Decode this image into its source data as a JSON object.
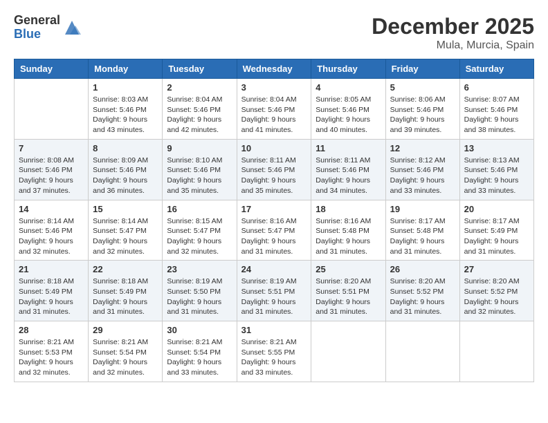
{
  "logo": {
    "general": "General",
    "blue": "Blue"
  },
  "title": "December 2025",
  "location": "Mula, Murcia, Spain",
  "days_of_week": [
    "Sunday",
    "Monday",
    "Tuesday",
    "Wednesday",
    "Thursday",
    "Friday",
    "Saturday"
  ],
  "weeks": [
    [
      {
        "day": "",
        "info": ""
      },
      {
        "day": "1",
        "info": "Sunrise: 8:03 AM\nSunset: 5:46 PM\nDaylight: 9 hours\nand 43 minutes."
      },
      {
        "day": "2",
        "info": "Sunrise: 8:04 AM\nSunset: 5:46 PM\nDaylight: 9 hours\nand 42 minutes."
      },
      {
        "day": "3",
        "info": "Sunrise: 8:04 AM\nSunset: 5:46 PM\nDaylight: 9 hours\nand 41 minutes."
      },
      {
        "day": "4",
        "info": "Sunrise: 8:05 AM\nSunset: 5:46 PM\nDaylight: 9 hours\nand 40 minutes."
      },
      {
        "day": "5",
        "info": "Sunrise: 8:06 AM\nSunset: 5:46 PM\nDaylight: 9 hours\nand 39 minutes."
      },
      {
        "day": "6",
        "info": "Sunrise: 8:07 AM\nSunset: 5:46 PM\nDaylight: 9 hours\nand 38 minutes."
      }
    ],
    [
      {
        "day": "7",
        "info": "Sunrise: 8:08 AM\nSunset: 5:46 PM\nDaylight: 9 hours\nand 37 minutes."
      },
      {
        "day": "8",
        "info": "Sunrise: 8:09 AM\nSunset: 5:46 PM\nDaylight: 9 hours\nand 36 minutes."
      },
      {
        "day": "9",
        "info": "Sunrise: 8:10 AM\nSunset: 5:46 PM\nDaylight: 9 hours\nand 35 minutes."
      },
      {
        "day": "10",
        "info": "Sunrise: 8:11 AM\nSunset: 5:46 PM\nDaylight: 9 hours\nand 35 minutes."
      },
      {
        "day": "11",
        "info": "Sunrise: 8:11 AM\nSunset: 5:46 PM\nDaylight: 9 hours\nand 34 minutes."
      },
      {
        "day": "12",
        "info": "Sunrise: 8:12 AM\nSunset: 5:46 PM\nDaylight: 9 hours\nand 33 minutes."
      },
      {
        "day": "13",
        "info": "Sunrise: 8:13 AM\nSunset: 5:46 PM\nDaylight: 9 hours\nand 33 minutes."
      }
    ],
    [
      {
        "day": "14",
        "info": "Sunrise: 8:14 AM\nSunset: 5:46 PM\nDaylight: 9 hours\nand 32 minutes."
      },
      {
        "day": "15",
        "info": "Sunrise: 8:14 AM\nSunset: 5:47 PM\nDaylight: 9 hours\nand 32 minutes."
      },
      {
        "day": "16",
        "info": "Sunrise: 8:15 AM\nSunset: 5:47 PM\nDaylight: 9 hours\nand 32 minutes."
      },
      {
        "day": "17",
        "info": "Sunrise: 8:16 AM\nSunset: 5:47 PM\nDaylight: 9 hours\nand 31 minutes."
      },
      {
        "day": "18",
        "info": "Sunrise: 8:16 AM\nSunset: 5:48 PM\nDaylight: 9 hours\nand 31 minutes."
      },
      {
        "day": "19",
        "info": "Sunrise: 8:17 AM\nSunset: 5:48 PM\nDaylight: 9 hours\nand 31 minutes."
      },
      {
        "day": "20",
        "info": "Sunrise: 8:17 AM\nSunset: 5:49 PM\nDaylight: 9 hours\nand 31 minutes."
      }
    ],
    [
      {
        "day": "21",
        "info": "Sunrise: 8:18 AM\nSunset: 5:49 PM\nDaylight: 9 hours\nand 31 minutes."
      },
      {
        "day": "22",
        "info": "Sunrise: 8:18 AM\nSunset: 5:49 PM\nDaylight: 9 hours\nand 31 minutes."
      },
      {
        "day": "23",
        "info": "Sunrise: 8:19 AM\nSunset: 5:50 PM\nDaylight: 9 hours\nand 31 minutes."
      },
      {
        "day": "24",
        "info": "Sunrise: 8:19 AM\nSunset: 5:51 PM\nDaylight: 9 hours\nand 31 minutes."
      },
      {
        "day": "25",
        "info": "Sunrise: 8:20 AM\nSunset: 5:51 PM\nDaylight: 9 hours\nand 31 minutes."
      },
      {
        "day": "26",
        "info": "Sunrise: 8:20 AM\nSunset: 5:52 PM\nDaylight: 9 hours\nand 31 minutes."
      },
      {
        "day": "27",
        "info": "Sunrise: 8:20 AM\nSunset: 5:52 PM\nDaylight: 9 hours\nand 32 minutes."
      }
    ],
    [
      {
        "day": "28",
        "info": "Sunrise: 8:21 AM\nSunset: 5:53 PM\nDaylight: 9 hours\nand 32 minutes."
      },
      {
        "day": "29",
        "info": "Sunrise: 8:21 AM\nSunset: 5:54 PM\nDaylight: 9 hours\nand 32 minutes."
      },
      {
        "day": "30",
        "info": "Sunrise: 8:21 AM\nSunset: 5:54 PM\nDaylight: 9 hours\nand 33 minutes."
      },
      {
        "day": "31",
        "info": "Sunrise: 8:21 AM\nSunset: 5:55 PM\nDaylight: 9 hours\nand 33 minutes."
      },
      {
        "day": "",
        "info": ""
      },
      {
        "day": "",
        "info": ""
      },
      {
        "day": "",
        "info": ""
      }
    ]
  ]
}
